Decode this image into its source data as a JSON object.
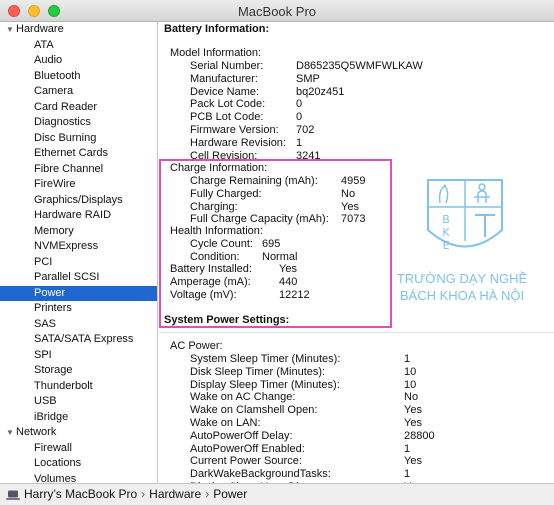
{
  "window": {
    "title": "MacBook Pro"
  },
  "sidebar": {
    "hardware_group": "Hardware",
    "hardware_items": [
      "ATA",
      "Audio",
      "Bluetooth",
      "Camera",
      "Card Reader",
      "Diagnostics",
      "Disc Burning",
      "Ethernet Cards",
      "Fibre Channel",
      "FireWire",
      "Graphics/Displays",
      "Hardware RAID",
      "Memory",
      "NVMExpress",
      "PCI",
      "Parallel SCSI",
      "Power",
      "Printers",
      "SAS",
      "SATA/SATA Express",
      "SPI",
      "Storage",
      "Thunderbolt",
      "USB",
      "iBridge"
    ],
    "selected_item": "Power",
    "network_group": "Network",
    "network_items": [
      "Firewall",
      "Locations",
      "Volumes"
    ]
  },
  "battery": {
    "heading": "Battery Information:",
    "model_heading": "Model Information:",
    "model": [
      {
        "label": "Serial Number:",
        "value": "D865235Q5WMFWLKAW"
      },
      {
        "label": "Manufacturer:",
        "value": "SMP"
      },
      {
        "label": "Device Name:",
        "value": "bq20z451"
      },
      {
        "label": "Pack Lot Code:",
        "value": "0"
      },
      {
        "label": "PCB Lot Code:",
        "value": "0"
      },
      {
        "label": "Firmware Version:",
        "value": "702"
      },
      {
        "label": "Hardware Revision:",
        "value": "1"
      },
      {
        "label": "Cell Revision:",
        "value": "3241"
      }
    ],
    "charge_heading": "Charge Information:",
    "charge": [
      {
        "label": "Charge Remaining (mAh):",
        "value": "4959"
      },
      {
        "label": "Fully Charged:",
        "value": "No"
      },
      {
        "label": "Charging:",
        "value": "Yes"
      },
      {
        "label": "Full Charge Capacity (mAh):",
        "value": "7073"
      }
    ],
    "health_heading": "Health Information:",
    "health": [
      {
        "label": "Cycle Count:",
        "value": "695"
      },
      {
        "label": "Condition:",
        "value": "Normal"
      }
    ],
    "misc": [
      {
        "label": "Battery Installed:",
        "value": "Yes"
      },
      {
        "label": "Amperage (mA):",
        "value": "440"
      },
      {
        "label": "Voltage (mV):",
        "value": "12212"
      }
    ]
  },
  "power_settings": {
    "heading": "System Power Settings:",
    "ac_heading": "AC Power:",
    "rows": [
      {
        "label": "System Sleep Timer (Minutes):",
        "value": "1"
      },
      {
        "label": "Disk Sleep Timer (Minutes):",
        "value": "10"
      },
      {
        "label": "Display Sleep Timer (Minutes):",
        "value": "10"
      },
      {
        "label": "Wake on AC Change:",
        "value": "No"
      },
      {
        "label": "Wake on Clamshell Open:",
        "value": "Yes"
      },
      {
        "label": "Wake on LAN:",
        "value": "Yes"
      },
      {
        "label": "AutoPowerOff Delay:",
        "value": "28800"
      },
      {
        "label": "AutoPowerOff Enabled:",
        "value": "1"
      },
      {
        "label": "Current Power Source:",
        "value": "Yes"
      },
      {
        "label": "DarkWakeBackgroundTasks:",
        "value": "1"
      },
      {
        "label": "Display Sleep Uses Dim:",
        "value": "Yes"
      }
    ]
  },
  "watermark": {
    "logo_letters": [
      "B",
      "K",
      "E"
    ],
    "line1": "TRƯỜNG DẠY NGHỀ",
    "line2": "BÁCH KHOA HÀ NỘI"
  },
  "pathbar": {
    "crumbs": [
      "Harry’s MacBook Pro",
      "Hardware",
      "Power"
    ],
    "separator": "›"
  },
  "colors": {
    "selection": "#1f66d0",
    "highlight_border": "#e04fb4",
    "watermark": "#7fc3ec"
  }
}
